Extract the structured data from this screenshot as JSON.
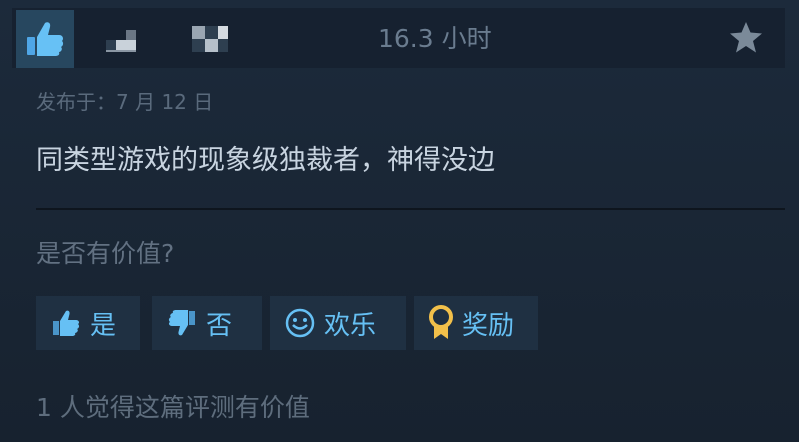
{
  "header": {
    "hours": "16.3 小时"
  },
  "review": {
    "posted": "发布于：7 月 12 日",
    "text": "同类型游戏的现象级独裁者，神得没边"
  },
  "helpful": {
    "question": "是否有价值?",
    "yes_label": "是",
    "no_label": "否",
    "funny_label": "欢乐",
    "award_label": "奖励",
    "count_text": "1 人觉得这篇评测有价值"
  },
  "colors": {
    "background": "#1b2838",
    "accent": "#66c0f4",
    "award": "#f2c04a"
  }
}
